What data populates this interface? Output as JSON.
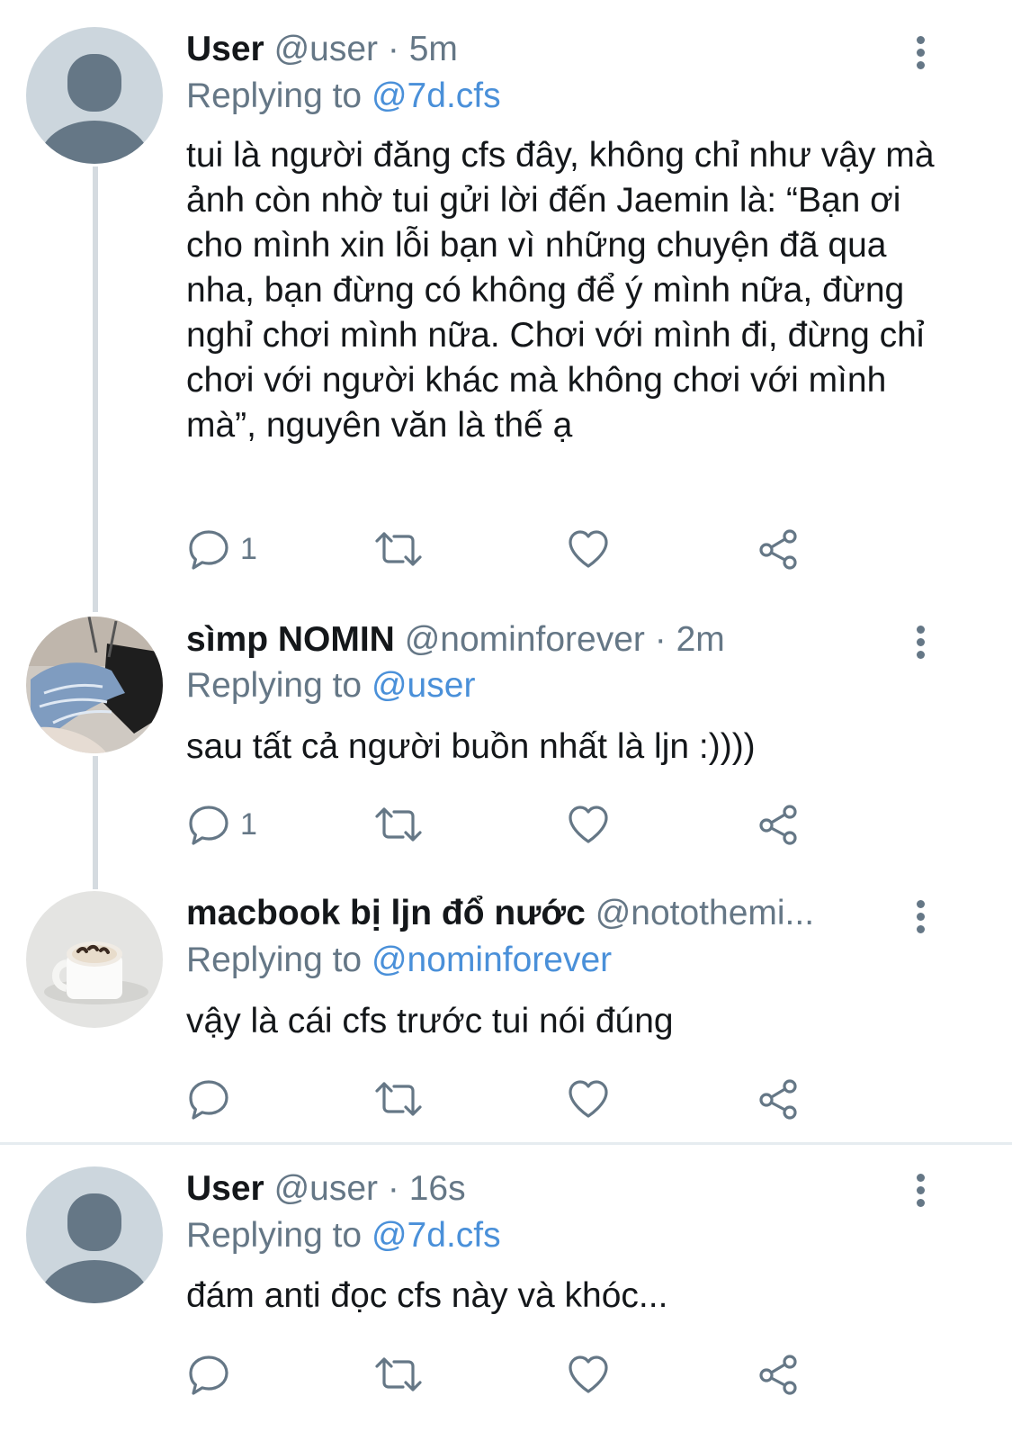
{
  "tweets": [
    {
      "name": "User",
      "handle": "@user",
      "sep": "·",
      "time": "5m",
      "replying_prefix": "Replying to",
      "replying_to": "@7d.cfs",
      "text": "tui là người đăng cfs đây, không chỉ như vậy mà ảnh còn nhờ tui gửi lời đến Jaemin là: “Bạn ơi cho mình xin lỗi bạn vì những chuyện đã qua nha, bạn đừng có không để ý mình nữa, đừng nghỉ chơi mình nữa. Chơi với mình đi, đừng chỉ chơi với người khác mà không chơi với mình mà”, nguyên văn là thế ạ",
      "reply_count": "1",
      "avatar": "default-avatar"
    },
    {
      "name": "sìmp NOMIN",
      "handle": "@nominforever",
      "sep": "·",
      "time": "2m",
      "replying_prefix": "Replying to",
      "replying_to": "@user",
      "text": "sau tất cả người buồn nhất là ljn :))))",
      "reply_count": "1",
      "avatar": "photo-avatar-legs"
    },
    {
      "name": "macbook bị ljn đổ nước",
      "handle": "@notothemi...",
      "sep": "",
      "time": "",
      "replying_prefix": "Replying to",
      "replying_to": "@nominforever",
      "text": "vậy là cái cfs trước tui nói đúng",
      "reply_count": "",
      "avatar": "photo-avatar-coffee-mug"
    },
    {
      "name": "User",
      "handle": "@user",
      "sep": "·",
      "time": "16s",
      "replying_prefix": "Replying to",
      "replying_to": "@7d.cfs",
      "text": "đám anti đọc cfs này và khóc...",
      "reply_count": "",
      "avatar": "default-avatar"
    }
  ],
  "icons": {
    "reply": "reply-icon",
    "retweet": "retweet-icon",
    "like": "like-icon",
    "share": "share-icon",
    "more": "more-options-icon"
  },
  "colors": {
    "text": "#14171a",
    "muted": "#657786",
    "link": "#4a90d9",
    "thread_line": "#d5dbe0"
  }
}
